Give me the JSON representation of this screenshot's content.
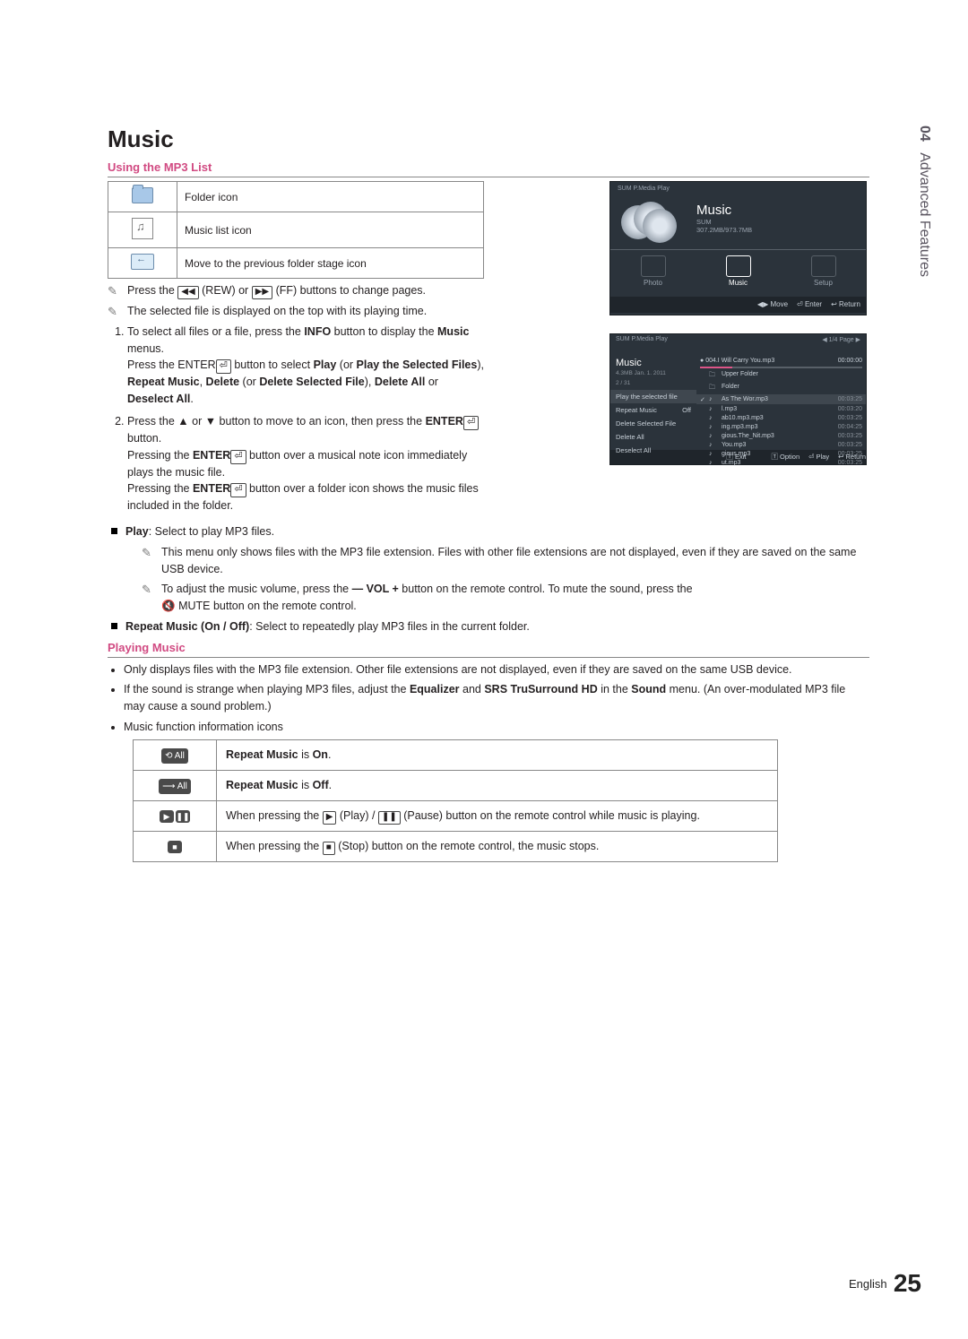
{
  "sidebar": {
    "chapter_no": "04",
    "chapter_title": "Advanced Features"
  },
  "section_title": "Music",
  "sub1": "Using the MP3 List",
  "icon_table": {
    "rows": [
      {
        "label": "Folder icon"
      },
      {
        "label": "Music list icon"
      },
      {
        "label": "Move to the previous folder stage icon"
      }
    ]
  },
  "notes": {
    "n1_a": "Press the ",
    "n1_b": " (REW) or ",
    "n1_c": " (FF) buttons to change pages.",
    "n2": "The selected file is displayed on the top with its playing time."
  },
  "steps": {
    "s1_a": "To select all files or a file, press the ",
    "s1_b": "INFO",
    "s1_c": " button to display the ",
    "s1_d": "Music",
    "s1_e": " menus.",
    "s1_x1": "Press the ENTER",
    "s1_x2": " button to select ",
    "s1_x3": "Play",
    "s1_x4": " (or ",
    "s1_x5": "Play the Selected Files",
    "s1_x6": "), ",
    "s1_x7": "Repeat Music",
    "s1_x8": ", ",
    "s1_x9": "Delete",
    "s1_x10": " (or ",
    "s1_x11": "Delete Selected File",
    "s1_x12": "), ",
    "s1_x13": "Delete All",
    "s1_x14": " or ",
    "s1_x15": "Deselect All",
    "s1_x16": ".",
    "s2_a": "Press the ▲ or ▼ button to move to an icon, then press the ",
    "s2_b": "ENTER",
    "s2_c": " button.",
    "s2_p1a": "Pressing the ",
    "s2_p1b": "ENTER",
    "s2_p1c": " button over a musical note icon immediately plays the music file.",
    "s2_p2a": "Pressing the ",
    "s2_p2b": "ENTER",
    "s2_p2c": " button over a folder icon shows the music files included in the folder."
  },
  "bullets": {
    "b1_label": "Play",
    "b1_rest": ": Select to play MP3 files.",
    "b1_note1": "This menu only shows files with the MP3 file extension. Files with other file extensions are not displayed, even if they are saved on the same USB device.",
    "b1_note2_a": "To adjust the music volume, press the ",
    "b1_note2_b": " button on the remote control. To mute the sound, press the ",
    "b1_note2_c": "MUTE button on the remote control.",
    "vol": "— VOL +",
    "mute_sym": "🔇",
    "b2_label": "Repeat Music (On / Off)",
    "b2_rest": ": Select to repeatedly play MP3 files in the current folder."
  },
  "sub2": "Playing Music",
  "dots": {
    "d1": "Only displays files with the MP3 file extension. Other file extensions are not displayed, even if they are saved on the same USB device.",
    "d2_a": "If the sound is strange when playing MP3 files, adjust the ",
    "d2_b": "Equalizer",
    "d2_c": " and ",
    "d2_d": "SRS TruSurround HD",
    "d2_e": " in the ",
    "d2_f": "Sound",
    "d2_g": " menu. (An over-modulated MP3 file may cause a sound problem.)",
    "d3": "Music function information icons"
  },
  "status_table": {
    "r1_badge": "⟲ All",
    "r1_a": "Repeat Music",
    "r1_b": " is ",
    "r1_c": "On",
    "r2_badge": "⟶ All",
    "r2_a": "Repeat Music",
    "r2_b": " is ",
    "r2_c": "Off",
    "r3_b1": "▶",
    "r3_b2": "❚❚",
    "r3_a": "When pressing the ",
    "r3_b": " (Play) / ",
    "r3_c": " (Pause) button on the remote control while music is playing.",
    "r4_b": "■",
    "r4_a": "When pressing the ",
    "r4_bt": " (Stop) button on the remote control, the music stops."
  },
  "fig1": {
    "crumb": "SUM\nP.Media Play",
    "title": "Music",
    "sum": "SUM",
    "storage": "307.2MB/973.7MB",
    "tiles": [
      "Photo",
      "Music",
      "Setup"
    ],
    "bottombar": [
      "◀▶ Move",
      "⏎ Enter",
      "↩ Return"
    ]
  },
  "fig2": {
    "crumb": "SUM  P.Media Play",
    "page": "◀  1/4 Page  ▶",
    "side_title": "Music",
    "side_meta": "4.3MB\nJan. 1. 2011",
    "side_count": "2 / 31",
    "menu": [
      {
        "label": "Play the selected file",
        "val": ""
      },
      {
        "label": "Repeat Music",
        "val": "Off"
      },
      {
        "label": "Delete Selected File",
        "val": ""
      },
      {
        "label": "Delete All",
        "val": ""
      },
      {
        "label": "Deselect All",
        "val": ""
      }
    ],
    "now_playing": {
      "idx": "4",
      "name": "004.I Will Carry You.mp3",
      "pos": "",
      "dur": "00:00:00"
    },
    "rows": [
      {
        "chk": "",
        "icon": "fold",
        "name": "Upper Folder",
        "dur": ""
      },
      {
        "chk": "",
        "icon": "fold",
        "name": "Folder",
        "dur": ""
      },
      {
        "chk": "✓",
        "icon": "note",
        "name": "As The Wor.mp3",
        "dur": "00:03:25"
      },
      {
        "chk": "",
        "icon": "note",
        "name": "l.mp3",
        "dur": "00:03:20"
      },
      {
        "chk": "",
        "icon": "note",
        "name": "ab10.mp3.mp3",
        "dur": "00:03:25"
      },
      {
        "chk": "",
        "icon": "note",
        "name": "ing.mp3.mp3",
        "dur": "00:04:25"
      },
      {
        "chk": "",
        "icon": "note",
        "name": "gious.The_Nit.mp3",
        "dur": "00:03:25"
      },
      {
        "chk": "",
        "icon": "note",
        "name": "You.mp3",
        "dur": "00:03:25"
      },
      {
        "chk": "",
        "icon": "note",
        "name": "gious.mp3",
        "dur": "00:03:25"
      },
      {
        "chk": "",
        "icon": "note",
        "name": "ut.mp3",
        "dur": "00:03:25"
      }
    ],
    "bottombar_left": "🅃 Exit",
    "bottombar_right": [
      "🅃 Option",
      "⏎ Play",
      "↩ Return"
    ]
  },
  "footer": {
    "lang": "English",
    "page": "25"
  },
  "rew_sym": "◀◀",
  "ff_sym": "▶▶",
  "play_sym": "▶",
  "pause_sym": "❚❚",
  "stop_sym": "■"
}
